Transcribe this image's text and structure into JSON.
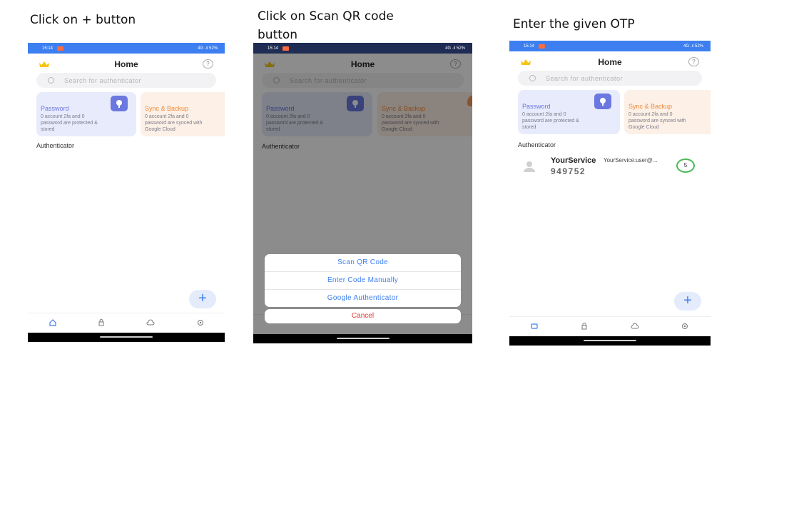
{
  "captions": {
    "step1": "Click on + button",
    "step2": "Click on Scan QR code button",
    "step3": "Enter the given OTP"
  },
  "status": {
    "time1": "15:14",
    "time2": "15:14",
    "time3": "15:14",
    "right": "4G .ıl 52%"
  },
  "home": {
    "title": "Home",
    "help": "?",
    "search_placeholder": "Search for authenticator",
    "password_card": {
      "title": "Password",
      "desc": "0 account 2fa and 0\npassword are protected &\nstored"
    },
    "sync_card": {
      "title": "Sync & Backup",
      "desc": "0 account 2fa and 0\npassword are synced with\nGoogle Cloud"
    },
    "section": "Authenticator",
    "fab": "+"
  },
  "sheet": {
    "options": [
      "Scan QR Code",
      "Enter Code Manually",
      "Google Authenticator"
    ],
    "cancel": "Cancel"
  },
  "account": {
    "service": "YourService",
    "account": "YourService:user@...",
    "code": "949752",
    "timer": "5"
  },
  "colors": {
    "accent": "#3d7ff0",
    "password": "#6b78e0",
    "sync": "#f08a3c",
    "cancel": "#e53935",
    "timer": "#4cbb5a"
  }
}
